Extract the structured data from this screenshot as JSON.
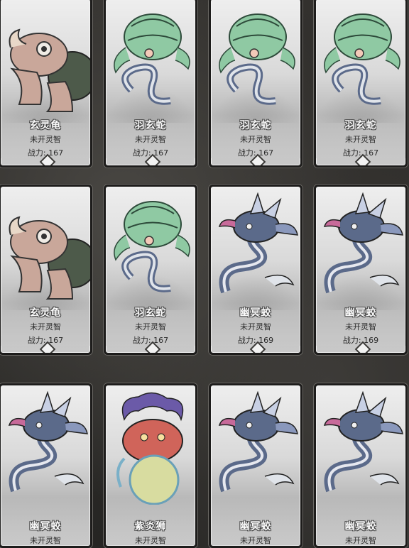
{
  "cards": [
    {
      "name": "玄灵龟",
      "status": "未开灵智",
      "power": "战力: 167",
      "creature": "turtle"
    },
    {
      "name": "羽玄蛇",
      "status": "未开灵智",
      "power": "战力: 167",
      "creature": "feathered-snake"
    },
    {
      "name": "羽玄蛇",
      "status": "未开灵智",
      "power": "战力: 167",
      "creature": "feathered-snake"
    },
    {
      "name": "羽玄蛇",
      "status": "未开灵智",
      "power": "战力: 167",
      "creature": "feathered-snake"
    },
    {
      "name": "玄灵龟",
      "status": "未开灵智",
      "power": "战力: 167",
      "creature": "turtle"
    },
    {
      "name": "羽玄蛇",
      "status": "未开灵智",
      "power": "战力: 167",
      "creature": "feathered-snake"
    },
    {
      "name": "幽冥蛟",
      "status": "未开灵智",
      "power": "战力: 169",
      "creature": "dragon"
    },
    {
      "name": "幽冥蛟",
      "status": "未开灵智",
      "power": "战力: 169",
      "creature": "dragon"
    },
    {
      "name": "幽冥蛟",
      "status": "未开灵智",
      "power": "",
      "creature": "dragon"
    },
    {
      "name": "紫炎狮",
      "status": "未开灵智",
      "power": "",
      "creature": "lion"
    },
    {
      "name": "幽冥蛟",
      "status": "未开灵智",
      "power": "",
      "creature": "dragon"
    },
    {
      "name": "幽冥蛟",
      "status": "未开灵智",
      "power": "",
      "creature": "dragon"
    }
  ],
  "colors": {
    "frame": "#1d1c1b",
    "turtle": "#c9a79a",
    "snake": "#8fc9a3",
    "dragon": "#5b6a8a",
    "lion": "#d0645a"
  }
}
